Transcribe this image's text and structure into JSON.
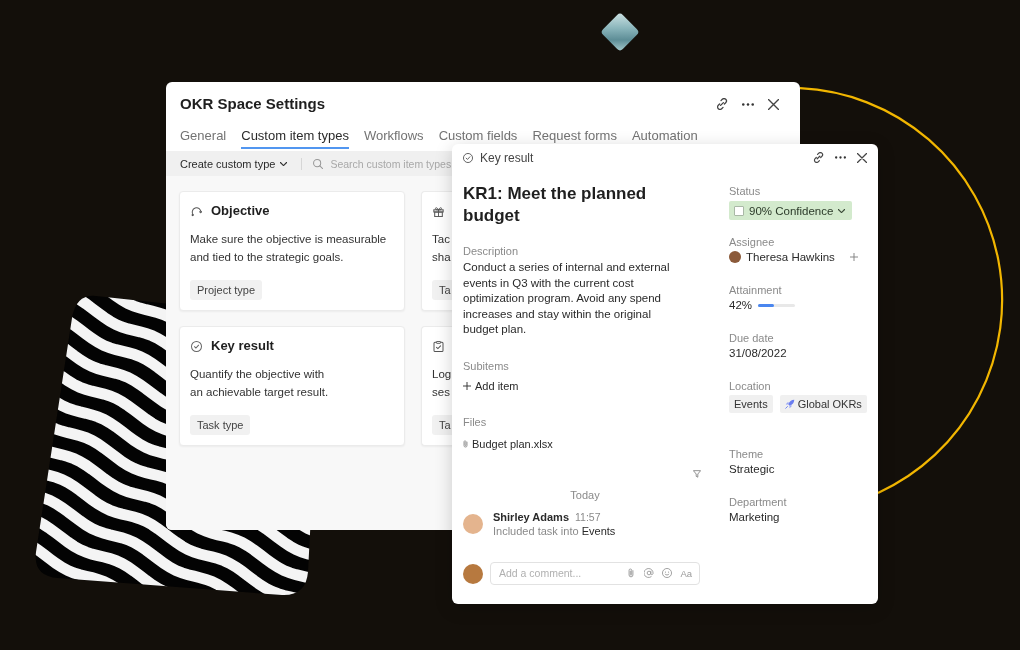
{
  "settings_window": {
    "title": "OKR Space Settings",
    "tabs": [
      {
        "label": "General",
        "selected": false
      },
      {
        "label": "Custom item types",
        "selected": true
      },
      {
        "label": "Workflows",
        "selected": false
      },
      {
        "label": "Custom fields",
        "selected": false
      },
      {
        "label": "Request forms",
        "selected": false
      },
      {
        "label": "Automation",
        "selected": false
      }
    ],
    "toolbar": {
      "create_button": "Create custom type",
      "search": {
        "placeholder": "Search custom item types"
      }
    },
    "cards": [
      {
        "title": "Objective",
        "description": "Make sure the objective is measurable\nand tied to the strategic goals.",
        "tag": "Project type"
      },
      {
        "description": "Tac\nsha",
        "tag": "Ta"
      },
      {
        "title": "Key result",
        "description": "Quantify the objective with\nan achievable target result.",
        "tag": "Task type"
      },
      {
        "description": "Log\nses",
        "tag": "Ta"
      }
    ]
  },
  "detail_panel": {
    "type_label": "Key result",
    "title": "KR1: Meet the planned budget",
    "description_label": "Description",
    "description": "Conduct a series of internal and external\nevents in Q3 with the current cost\noptimization program. Avoid any spend\nincreases and stay within the original\nbudget plan.",
    "subitems_label": "Subitems",
    "add_item": "Add item",
    "files_label": "Files",
    "files": [
      "Budget plan.xlsx"
    ],
    "activity": {
      "date": "Today",
      "entries": [
        {
          "author": "Shirley Adams",
          "time": "11:57",
          "text": "Included task into",
          "target": "Events"
        }
      ]
    },
    "comment": {
      "placeholder": "Add a comment...",
      "format_button": "Aa"
    },
    "fields": [
      {
        "label": "Status",
        "kind": "status",
        "value": "90% Confidence"
      },
      {
        "label": "Assignee",
        "kind": "person",
        "value": "Theresa Hawkins"
      },
      {
        "label": "Attainment",
        "kind": "progress",
        "value": "42%",
        "level": 0.42
      },
      {
        "label": "Due date",
        "kind": "text",
        "value": "31/08/2022"
      },
      {
        "label": "Location",
        "kind": "tags",
        "tags": [
          {
            "label": "Events",
            "kind": "plain"
          },
          {
            "label": "Global OKRs",
            "kind": "space"
          }
        ]
      },
      {
        "label": "Theme",
        "kind": "text",
        "value": "Strategic"
      },
      {
        "label": "Department",
        "kind": "text",
        "value": "Marketing"
      }
    ]
  }
}
